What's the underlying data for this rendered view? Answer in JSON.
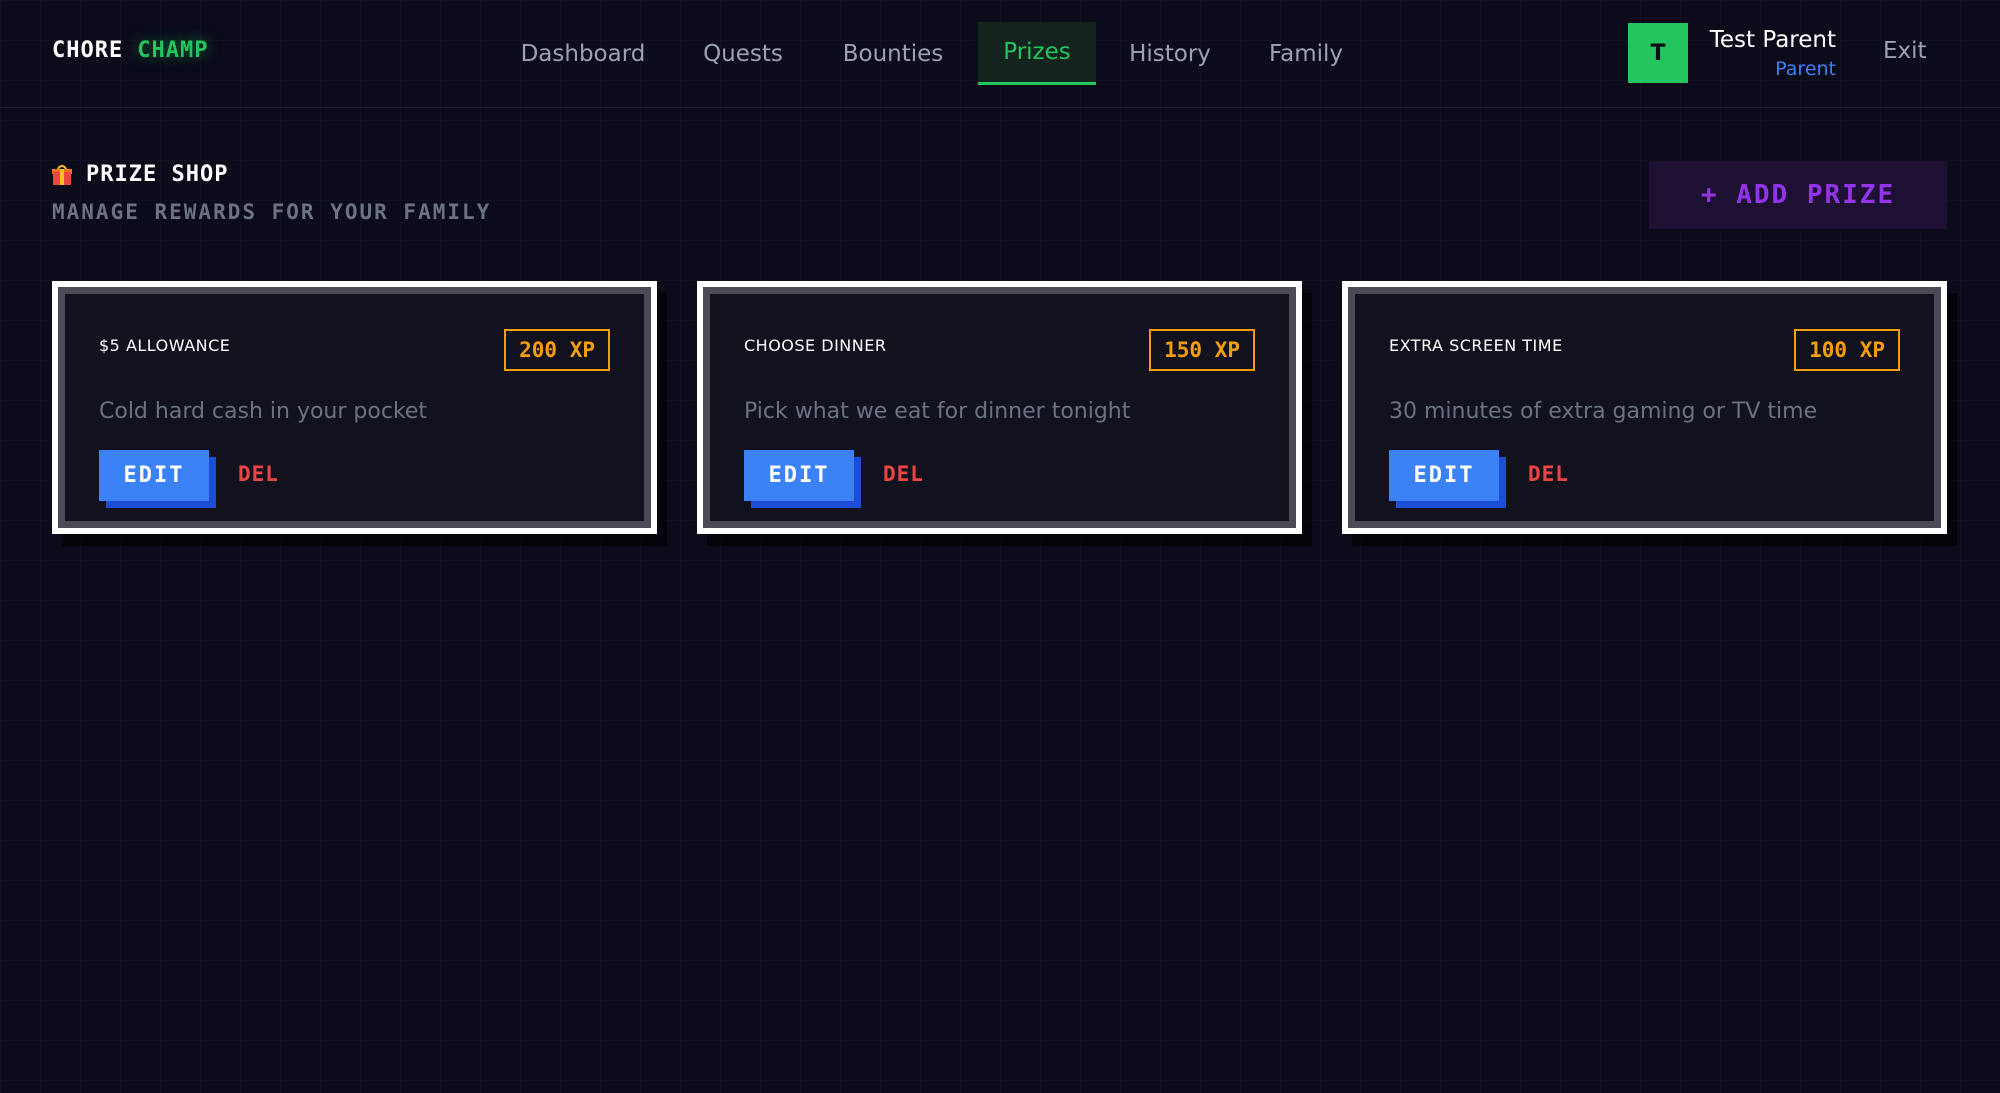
{
  "header": {
    "logo": {
      "word1": "CHORE",
      "word2": "CHAMP"
    },
    "nav": [
      {
        "label": "Dashboard",
        "active": false
      },
      {
        "label": "Quests",
        "active": false
      },
      {
        "label": "Bounties",
        "active": false
      },
      {
        "label": "Prizes",
        "active": true
      },
      {
        "label": "History",
        "active": false
      },
      {
        "label": "Family",
        "active": false
      }
    ],
    "user": {
      "initial": "T",
      "name": "Test Parent",
      "role": "Parent"
    },
    "exit_label": "Exit"
  },
  "page": {
    "title": "PRIZE SHOP",
    "title_icon": "gift-icon",
    "subtitle": "MANAGE REWARDS FOR YOUR FAMILY",
    "add_button_label": "+ ADD PRIZE"
  },
  "prizes": [
    {
      "name": "$5 ALLOWANCE",
      "xp": "200 XP",
      "description": "Cold hard cash in your pocket",
      "edit_label": "EDIT",
      "delete_label": "DEL"
    },
    {
      "name": "CHOOSE DINNER",
      "xp": "150 XP",
      "description": "Pick what we eat for dinner tonight",
      "edit_label": "EDIT",
      "delete_label": "DEL"
    },
    {
      "name": "EXTRA SCREEN TIME",
      "xp": "100 XP",
      "description": "30 minutes of extra gaming or TV time",
      "edit_label": "EDIT",
      "delete_label": "DEL"
    }
  ],
  "colors": {
    "background": "#0b0b1a",
    "accent_green": "#22c55e",
    "accent_blue": "#3b82f6",
    "accent_purple": "#9333ea",
    "xp_orange": "#f59e0b",
    "danger_red": "#ef4444"
  }
}
